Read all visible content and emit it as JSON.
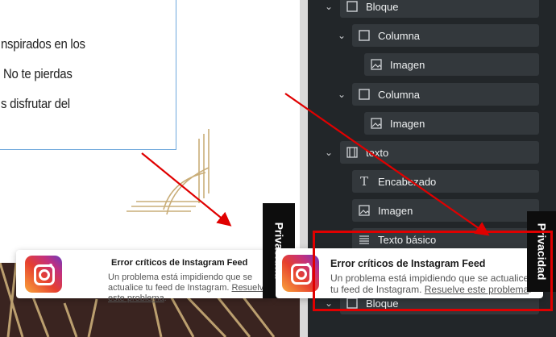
{
  "article": {
    "lines": [
      "nspirados en los",
      "No te pierdas",
      "s disfrutar del"
    ]
  },
  "privacy_label": "Privacidad",
  "tree": [
    {
      "label": "Bloque",
      "icon": "block-icon"
    },
    {
      "label": "Columna",
      "icon": "column-icon"
    },
    {
      "label": "Imagen",
      "icon": "image-icon"
    },
    {
      "label": "Columna",
      "icon": "column-icon"
    },
    {
      "label": "Imagen",
      "icon": "image-icon"
    },
    {
      "label": "texto",
      "icon": "group-icon"
    },
    {
      "label": "Encabezado",
      "icon": "heading-icon"
    },
    {
      "label": "Imagen",
      "icon": "image-icon"
    },
    {
      "label": "Texto básico",
      "icon": "paragraph-icon"
    },
    {
      "label": "Bloque",
      "icon": "block-icon"
    }
  ],
  "toast": {
    "title": "Error críticos de Instagram Feed",
    "body": "Un problema está impidiendo que se actualice tu feed de Instagram.",
    "link": "Resuelve este problema",
    "end": "."
  },
  "colors": {
    "panel_bg": "#222629",
    "row_bg": "#33383c",
    "annotation_red": "#e00000"
  }
}
